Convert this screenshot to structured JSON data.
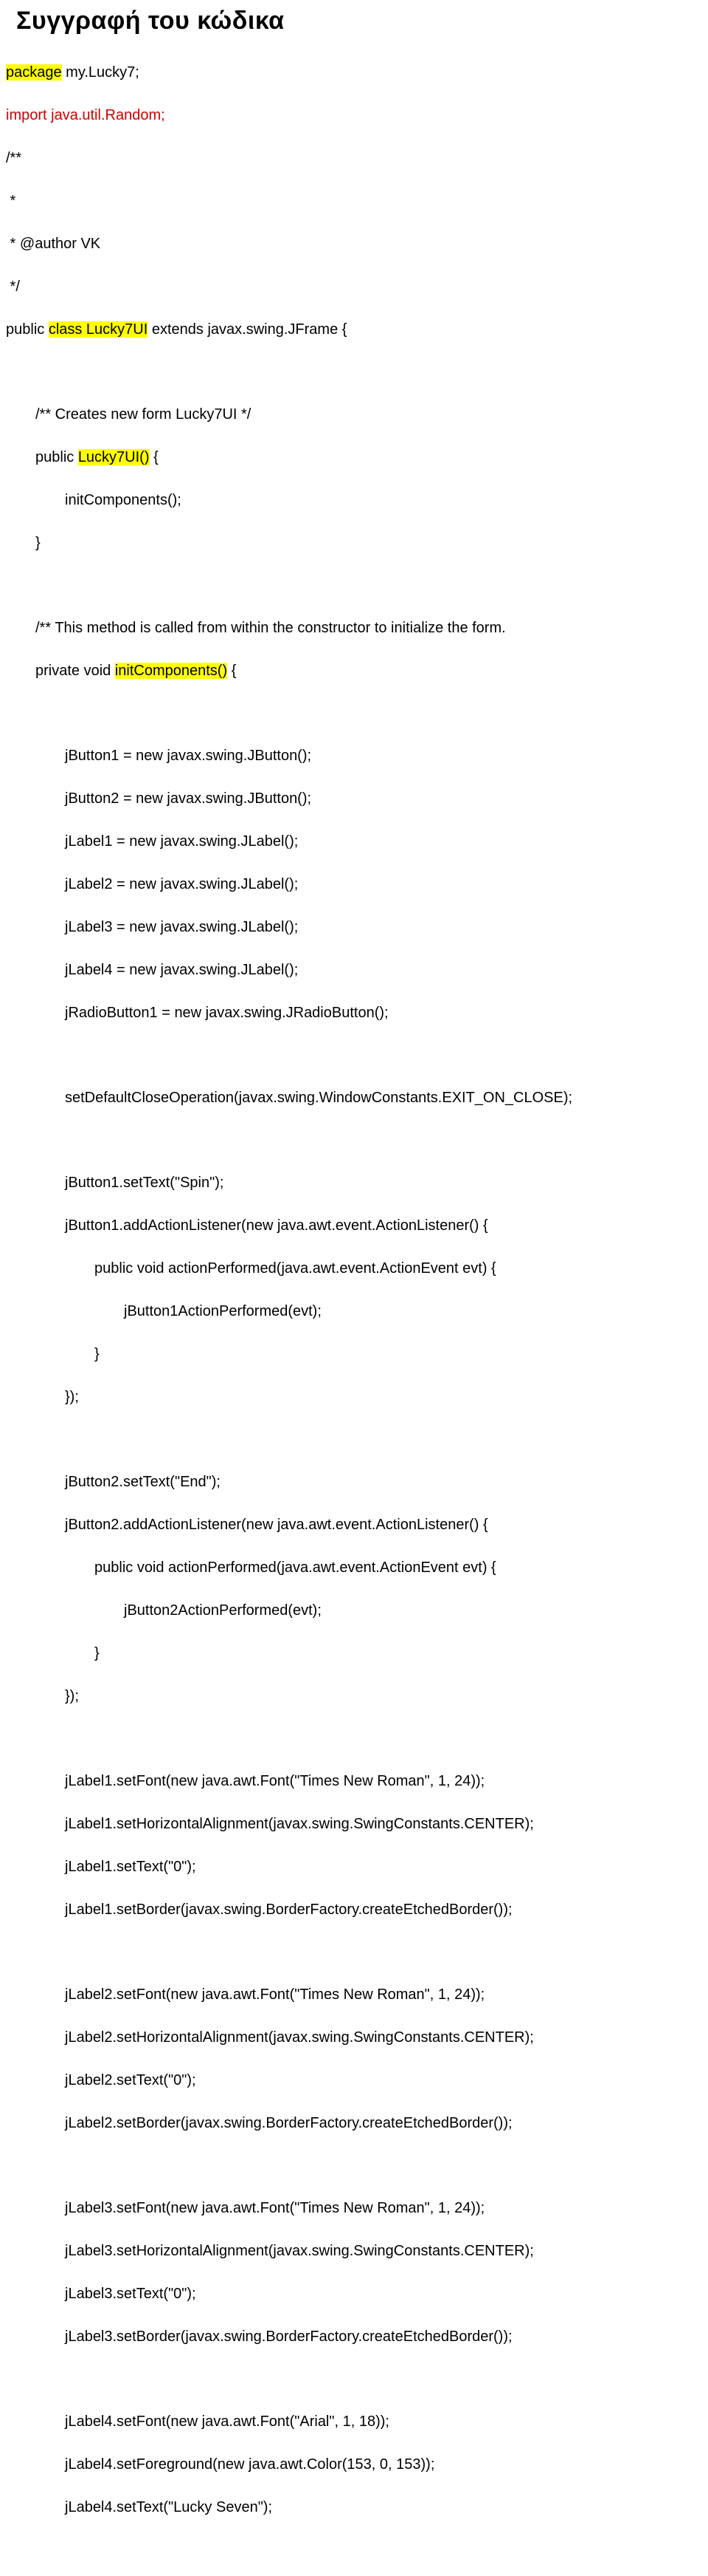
{
  "title": "Συγγραφή του κώδικα",
  "l1a": "package",
  "l1b": " my.Lucky7;",
  "l2a": "import",
  "l2b": " java.util.Random;",
  "l3": "/**",
  "l4": " *",
  "l5": " * @author VK",
  "l6": " */",
  "l7a": "public ",
  "l7b": "class Lucky7UI",
  "l7c": " extends javax.swing.JFrame {",
  "l8": "/** Creates new form Lucky7UI */",
  "l9a": "public ",
  "l9b": "Lucky7UI()",
  "l9c": " {",
  "l10": "initComponents();",
  "l11": "}",
  "l12": "/** This method is called from within the constructor to initialize the form.",
  "l13a": "private void ",
  "l13b": "initComponents()",
  "l13c": " {",
  "l14": "jButton1 = new javax.swing.JButton();",
  "l15": "jButton2 = new javax.swing.JButton();",
  "l16": "jLabel1 = new javax.swing.JLabel();",
  "l17": "jLabel2 = new javax.swing.JLabel();",
  "l18": "jLabel3 = new javax.swing.JLabel();",
  "l19": "jLabel4 = new javax.swing.JLabel();",
  "l20": "jRadioButton1 = new javax.swing.JRadioButton();",
  "l21": "setDefaultCloseOperation(javax.swing.WindowConstants.EXIT_ON_CLOSE);",
  "l22": "jButton1.setText(\"Spin\");",
  "l23": "jButton1.addActionListener(new java.awt.event.ActionListener() {",
  "l24": "public void actionPerformed(java.awt.event.ActionEvent evt) {",
  "l25": "jButton1ActionPerformed(evt);",
  "l26": "}",
  "l27": "});",
  "l28": "jButton2.setText(\"End\");",
  "l29": "jButton2.addActionListener(new java.awt.event.ActionListener() {",
  "l30": "public void actionPerformed(java.awt.event.ActionEvent evt) {",
  "l31": "jButton2ActionPerformed(evt);",
  "l32": "}",
  "l33": "});",
  "l34": "jLabel1.setFont(new java.awt.Font(\"Times New Roman\", 1, 24));",
  "l35": "jLabel1.setHorizontalAlignment(javax.swing.SwingConstants.CENTER);",
  "l36": "jLabel1.setText(\"0\");",
  "l37": "jLabel1.setBorder(javax.swing.BorderFactory.createEtchedBorder());",
  "l38": "jLabel2.setFont(new java.awt.Font(\"Times New Roman\", 1, 24));",
  "l39": "jLabel2.setHorizontalAlignment(javax.swing.SwingConstants.CENTER);",
  "l40": "jLabel2.setText(\"0\");",
  "l41": "jLabel2.setBorder(javax.swing.BorderFactory.createEtchedBorder());",
  "l42": "jLabel3.setFont(new java.awt.Font(\"Times New Roman\", 1, 24));",
  "l43": "jLabel3.setHorizontalAlignment(javax.swing.SwingConstants.CENTER);",
  "l44": "jLabel3.setText(\"0\");",
  "l45": "jLabel3.setBorder(javax.swing.BorderFactory.createEtchedBorder());",
  "l46": "jLabel4.setFont(new java.awt.Font(\"Arial\", 1, 18));",
  "l47": "jLabel4.setForeground(new java.awt.Color(153, 0, 153));",
  "l48": "jLabel4.setText(\"Lucky Seven\");"
}
